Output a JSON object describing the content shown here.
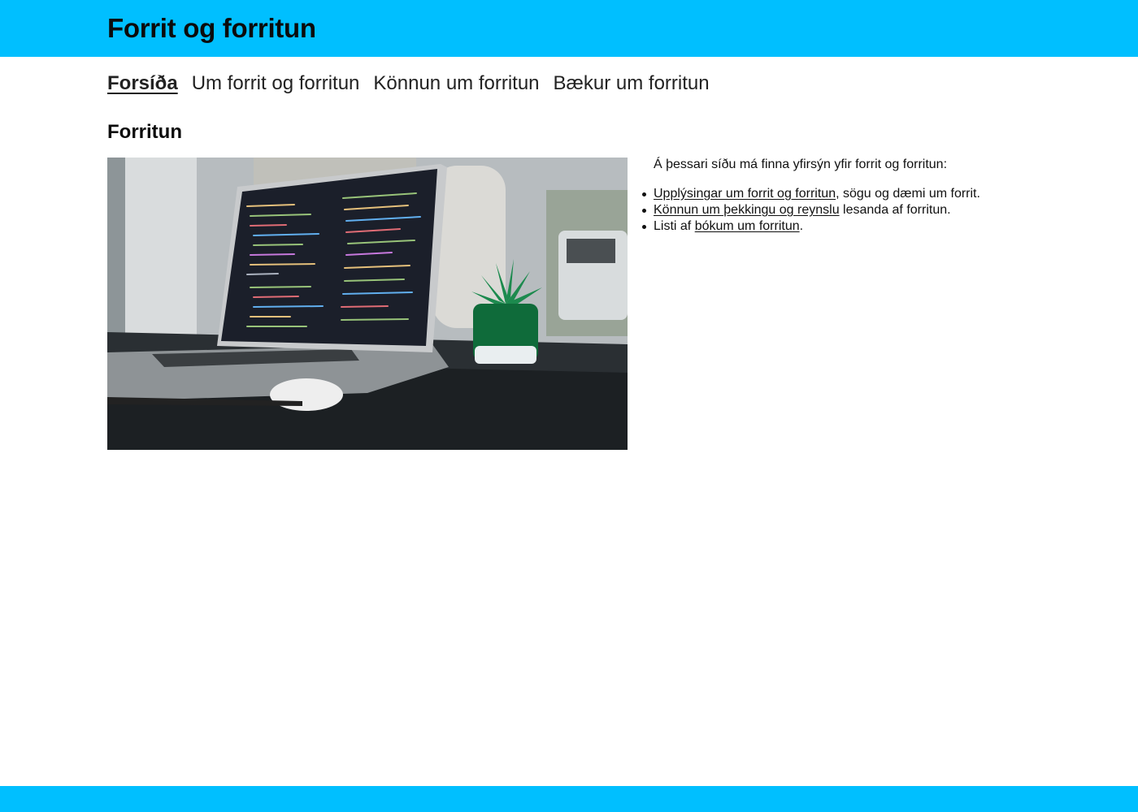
{
  "header": {
    "title": "Forrit og forritun",
    "background_color": "#00bfff"
  },
  "nav": {
    "items": [
      {
        "label": "Forsíða",
        "active": true
      },
      {
        "label": "Um forrit og forritun",
        "active": false
      },
      {
        "label": "Könnun um forritun",
        "active": false
      },
      {
        "label": "Bækur um forritun",
        "active": false
      }
    ]
  },
  "main": {
    "heading": "Forritun",
    "image": {
      "description": "laptop showing code on a desk next to a small potted succulent"
    },
    "intro": "Á þessari síðu má finna yfirsýn yfir forrit og forritun:",
    "list": [
      {
        "link_text": "Upplýsingar um forrit og forritun",
        "prefix": "",
        "suffix": ", sögu og dæmi um forrit."
      },
      {
        "link_text": "Könnun um þekkingu og reynslu",
        "prefix": "",
        "suffix": " lesanda af forritun."
      },
      {
        "link_text": "bókum um forritun",
        "prefix": "Listi af ",
        "suffix": "."
      }
    ]
  },
  "footer": {
    "background_color": "#00bfff"
  }
}
